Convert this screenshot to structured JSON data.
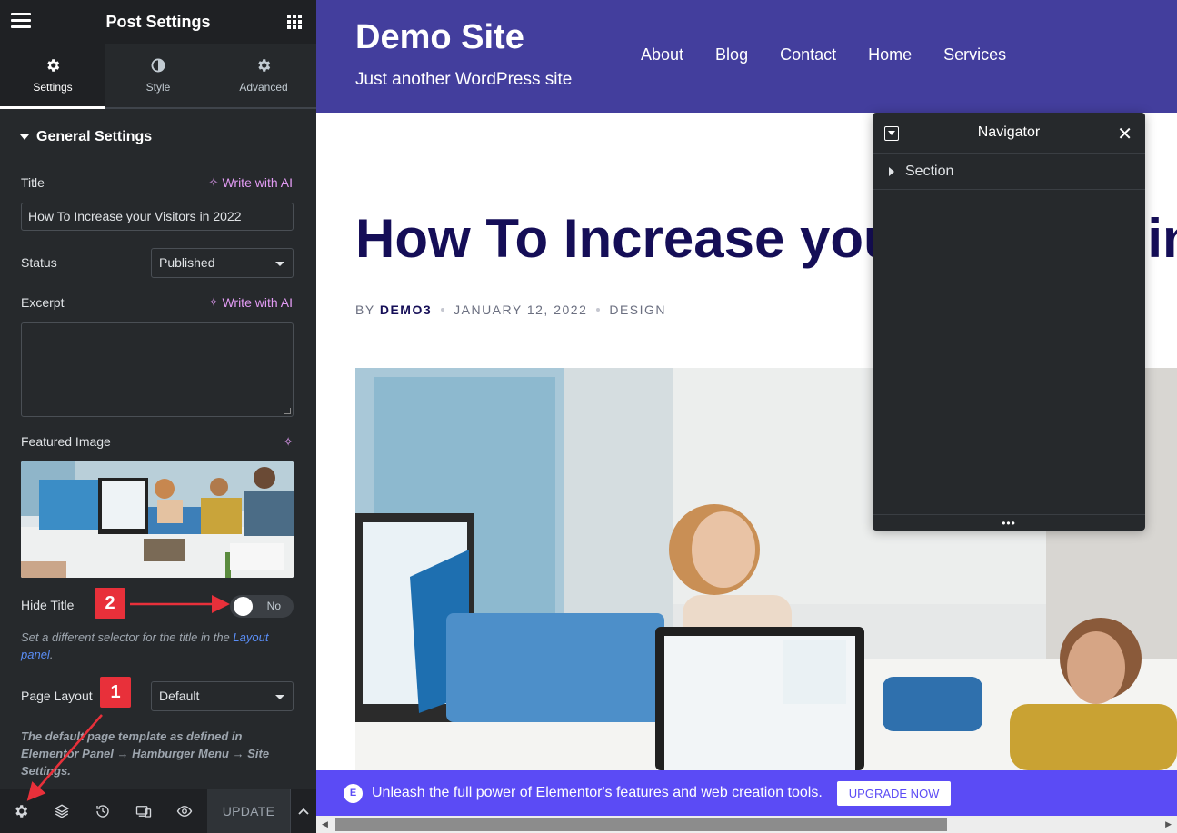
{
  "panel": {
    "title": "Post Settings",
    "tabs": [
      {
        "label": "Settings",
        "icon": "gear-icon"
      },
      {
        "label": "Style",
        "icon": "half-circle-icon"
      },
      {
        "label": "Advanced",
        "icon": "gear-icon"
      }
    ],
    "section_title": "General Settings",
    "title_label": "Title",
    "write_ai": "Write with AI",
    "title_value": "How To Increase your Visitors in 2022",
    "status_label": "Status",
    "status_value": "Published",
    "excerpt_label": "Excerpt",
    "excerpt_value": "",
    "featured_label": "Featured Image",
    "hide_title_label": "Hide Title",
    "hide_title_state": "No",
    "hide_help_text": "Set a different selector for the title in the ",
    "hide_help_link": "Layout panel",
    "hide_help_end": ".",
    "page_layout_label": "Page Layout",
    "page_layout_value": "Default",
    "page_layout_help": "The default page template as defined in Elementor Panel → Hamburger Menu → Site Settings.",
    "update_label": "UPDATE"
  },
  "annotations": {
    "badge_1": "1",
    "badge_2": "2",
    "color": "#e8303a"
  },
  "site": {
    "title": "Demo Site",
    "tagline": "Just another WordPress site",
    "nav": [
      "About",
      "Blog",
      "Contact",
      "Home",
      "Services"
    ],
    "header_color": "#433e9d"
  },
  "post": {
    "title": "How To Increase your Visitors in 2022",
    "meta_by": "BY",
    "meta_author": "DEMO3",
    "meta_date": "JANUARY 12, 2022",
    "meta_category": "DESIGN"
  },
  "navigator": {
    "title": "Navigator",
    "row_label": "Section"
  },
  "promo": {
    "message": "Unleash the full power of Elementor's features and web creation tools.",
    "button": "UPGRADE NOW",
    "color": "#5b4bf5"
  }
}
